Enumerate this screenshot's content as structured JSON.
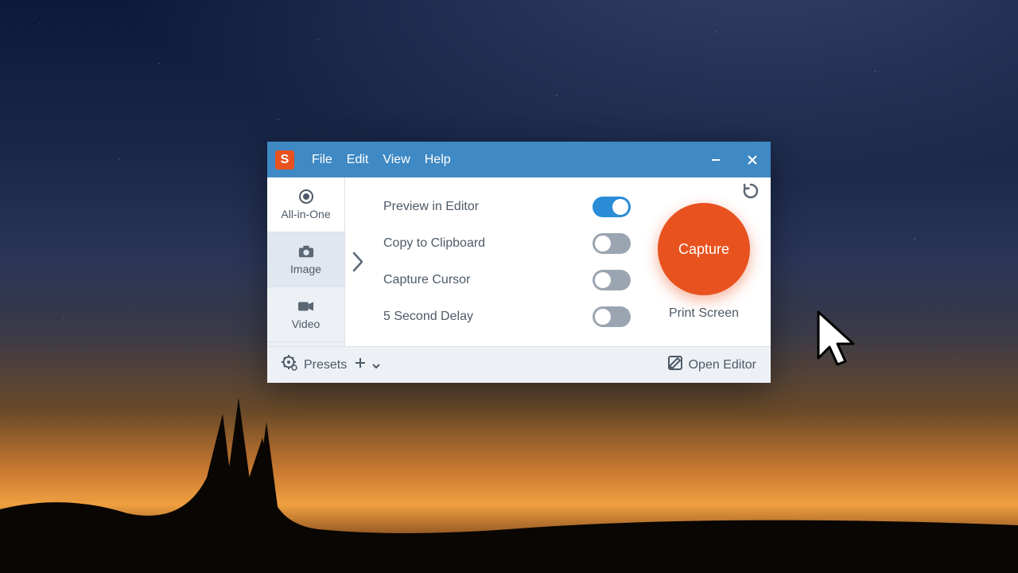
{
  "menu": {
    "file": "File",
    "edit": "Edit",
    "view": "View",
    "help": "Help"
  },
  "sidebar": {
    "items": [
      {
        "label": "All-in-One"
      },
      {
        "label": "Image"
      },
      {
        "label": "Video"
      }
    ]
  },
  "options": [
    {
      "label": "Preview in Editor",
      "checked": true
    },
    {
      "label": "Copy to Clipboard",
      "checked": false
    },
    {
      "label": "Capture Cursor",
      "checked": false
    },
    {
      "label": "5 Second Delay",
      "checked": false
    }
  ],
  "capture": {
    "button": "Capture",
    "hotkey": "Print Screen"
  },
  "footer": {
    "presets": "Presets",
    "open_editor": "Open Editor"
  },
  "colors": {
    "titlebar": "#3f89c4",
    "accent": "#e8521f",
    "toggle_on": "#2a8cd6"
  },
  "app_logo_glyph": "S"
}
